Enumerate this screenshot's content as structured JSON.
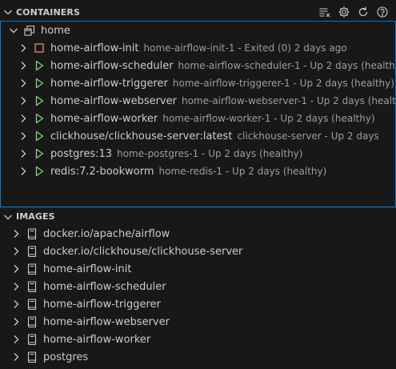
{
  "containers": {
    "title": "CONTAINERS",
    "group": {
      "label": "home"
    },
    "items": [
      {
        "name": "home-airflow-init",
        "status": "home-airflow-init-1 - Exited (0) 2 days ago",
        "state": "stopped"
      },
      {
        "name": "home-airflow-scheduler",
        "status": "home-airflow-scheduler-1 - Up 2 days (healthy)",
        "state": "running"
      },
      {
        "name": "home-airflow-triggerer",
        "status": "home-airflow-triggerer-1 - Up 2 days (healthy)",
        "state": "running"
      },
      {
        "name": "home-airflow-webserver",
        "status": "home-airflow-webserver-1 - Up 2 days (healthy)",
        "state": "running"
      },
      {
        "name": "home-airflow-worker",
        "status": "home-airflow-worker-1 - Up 2 days (healthy)",
        "state": "running"
      },
      {
        "name": "clickhouse/clickhouse-server:latest",
        "status": "clickhouse-server - Up 2 days",
        "state": "running"
      },
      {
        "name": "postgres:13",
        "status": "home-postgres-1 - Up 2 days (healthy)",
        "state": "running"
      },
      {
        "name": "redis:7.2-bookworm",
        "status": "home-redis-1 - Up 2 days (healthy)",
        "state": "running"
      }
    ]
  },
  "images": {
    "title": "IMAGES",
    "items": [
      {
        "name": "docker.io/apache/airflow"
      },
      {
        "name": "docker.io/clickhouse/clickhouse-server"
      },
      {
        "name": "home-airflow-init"
      },
      {
        "name": "home-airflow-scheduler"
      },
      {
        "name": "home-airflow-triggerer"
      },
      {
        "name": "home-airflow-webserver"
      },
      {
        "name": "home-airflow-worker"
      },
      {
        "name": "postgres"
      }
    ]
  },
  "icons": {
    "actions": [
      "clear-all-icon",
      "settings-gear-icon",
      "refresh-icon",
      "help-icon"
    ],
    "group": "window-stack-icon",
    "running": "play-triangle-icon",
    "stopped": "stop-square-icon",
    "image": "book-icon"
  },
  "colors": {
    "running": "#89d185",
    "stopped": "#f48771",
    "focus_border": "#0078d4"
  }
}
